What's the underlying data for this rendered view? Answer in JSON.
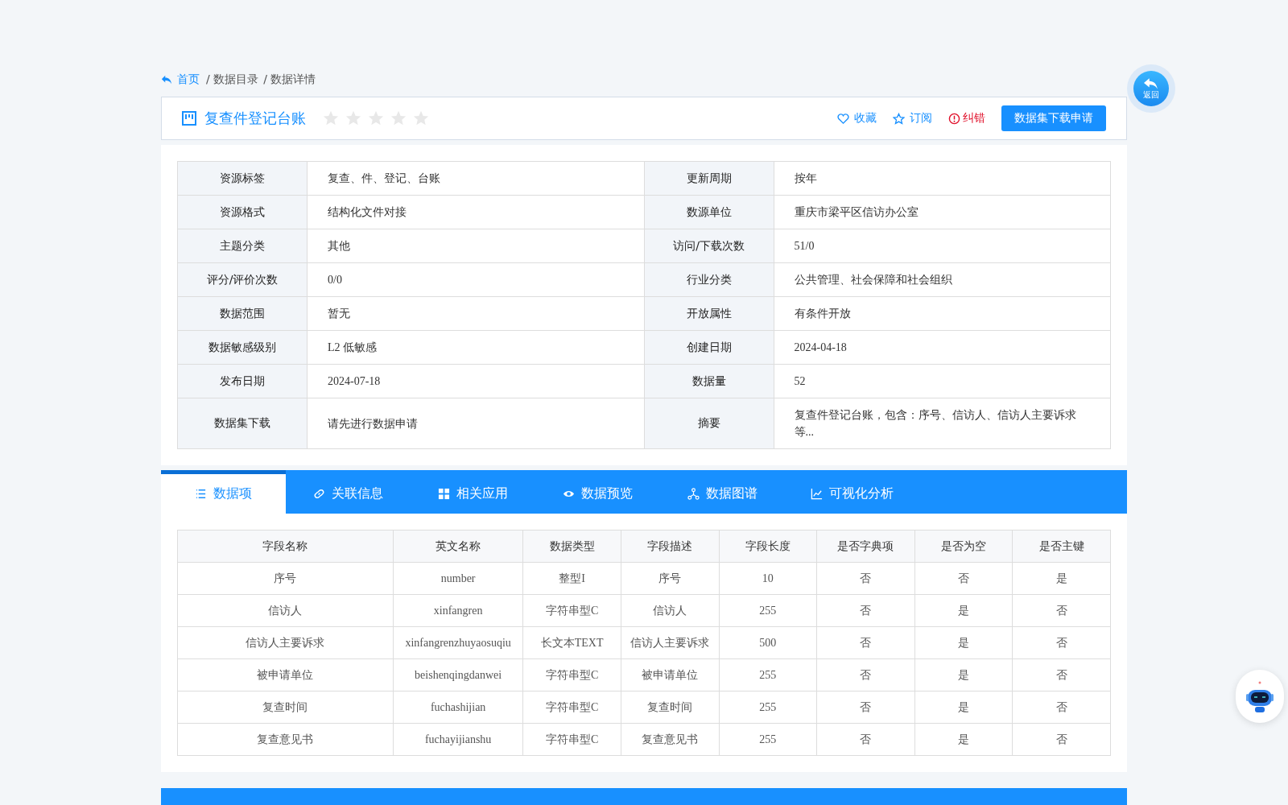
{
  "breadcrumb": [
    {
      "label": "首页",
      "kind": "home"
    },
    {
      "label": "/ 数据目录",
      "kind": "plain"
    },
    {
      "label": "/ 数据详情",
      "kind": "plain"
    }
  ],
  "header": {
    "title": "复查件登记台账",
    "stars": 0,
    "actions": [
      {
        "label": "收藏",
        "kind": "heart"
      },
      {
        "label": "订阅",
        "kind": "star"
      },
      {
        "label": "纠错",
        "kind": "error"
      }
    ],
    "apply_button": "数据集下载申请"
  },
  "back_button": {
    "label": "返回"
  },
  "info": [
    {
      "label": "资源标签",
      "value": "复查、件、登记、台账"
    },
    {
      "label": "更新周期",
      "value": "按年"
    },
    {
      "label": "资源格式",
      "value": "结构化文件对接"
    },
    {
      "label": "数源单位",
      "value": "重庆市梁平区信访办公室"
    },
    {
      "label": "主题分类",
      "value": "其他"
    },
    {
      "label": "访问/下载次数",
      "value": "51/0"
    },
    {
      "label": "评分/评价次数",
      "value": "0/0"
    },
    {
      "label": "行业分类",
      "value": "公共管理、社会保障和社会组织"
    },
    {
      "label": "数据范围",
      "value": "暂无"
    },
    {
      "label": "开放属性",
      "value": "有条件开放"
    },
    {
      "label": "数据敏感级别",
      "value": "L2 低敏感"
    },
    {
      "label": "创建日期",
      "value": "2024-04-18"
    },
    {
      "label": "发布日期",
      "value": "2024-07-18"
    },
    {
      "label": "数据量",
      "value": "52"
    },
    {
      "label": "数据集下载",
      "value": "请先进行数据申请"
    },
    {
      "label": "摘要",
      "value": "复查件登记台账，包含：序号、信访人、信访人主要诉求等..."
    }
  ],
  "tabs": [
    {
      "label": "数据项",
      "kind": "list",
      "selected": true
    },
    {
      "label": "关联信息",
      "kind": "link",
      "selected": false
    },
    {
      "label": "相关应用",
      "kind": "grid",
      "selected": false
    },
    {
      "label": "数据预览",
      "kind": "eye",
      "selected": false
    },
    {
      "label": "数据图谱",
      "kind": "graph",
      "selected": false
    },
    {
      "label": "可视化分析",
      "kind": "chart",
      "selected": false
    }
  ],
  "table": {
    "columns": [
      "字段名称",
      "英文名称",
      "数据类型",
      "字段描述",
      "字段长度",
      "是否字典项",
      "是否为空",
      "是否主键"
    ],
    "rows": [
      [
        "序号",
        "number",
        "整型I",
        "序号",
        "10",
        "否",
        "否",
        "是"
      ],
      [
        "信访人",
        "xinfangren",
        "字符串型C",
        "信访人",
        "255",
        "否",
        "是",
        "否"
      ],
      [
        "信访人主要诉求",
        "xinfangrenzhuyaosuqiu",
        "长文本TEXT",
        "信访人主要诉求",
        "500",
        "否",
        "是",
        "否"
      ],
      [
        "被申请单位",
        "beishenqingdanwei",
        "字符串型C",
        "被申请单位",
        "255",
        "否",
        "是",
        "否"
      ],
      [
        "复查时间",
        "fuchashijian",
        "字符串型C",
        "复查时间",
        "255",
        "否",
        "是",
        "否"
      ],
      [
        "复查意见书",
        "fuchayijianshu",
        "字符串型C",
        "复查意见书",
        "255",
        "否",
        "是",
        "否"
      ]
    ]
  }
}
